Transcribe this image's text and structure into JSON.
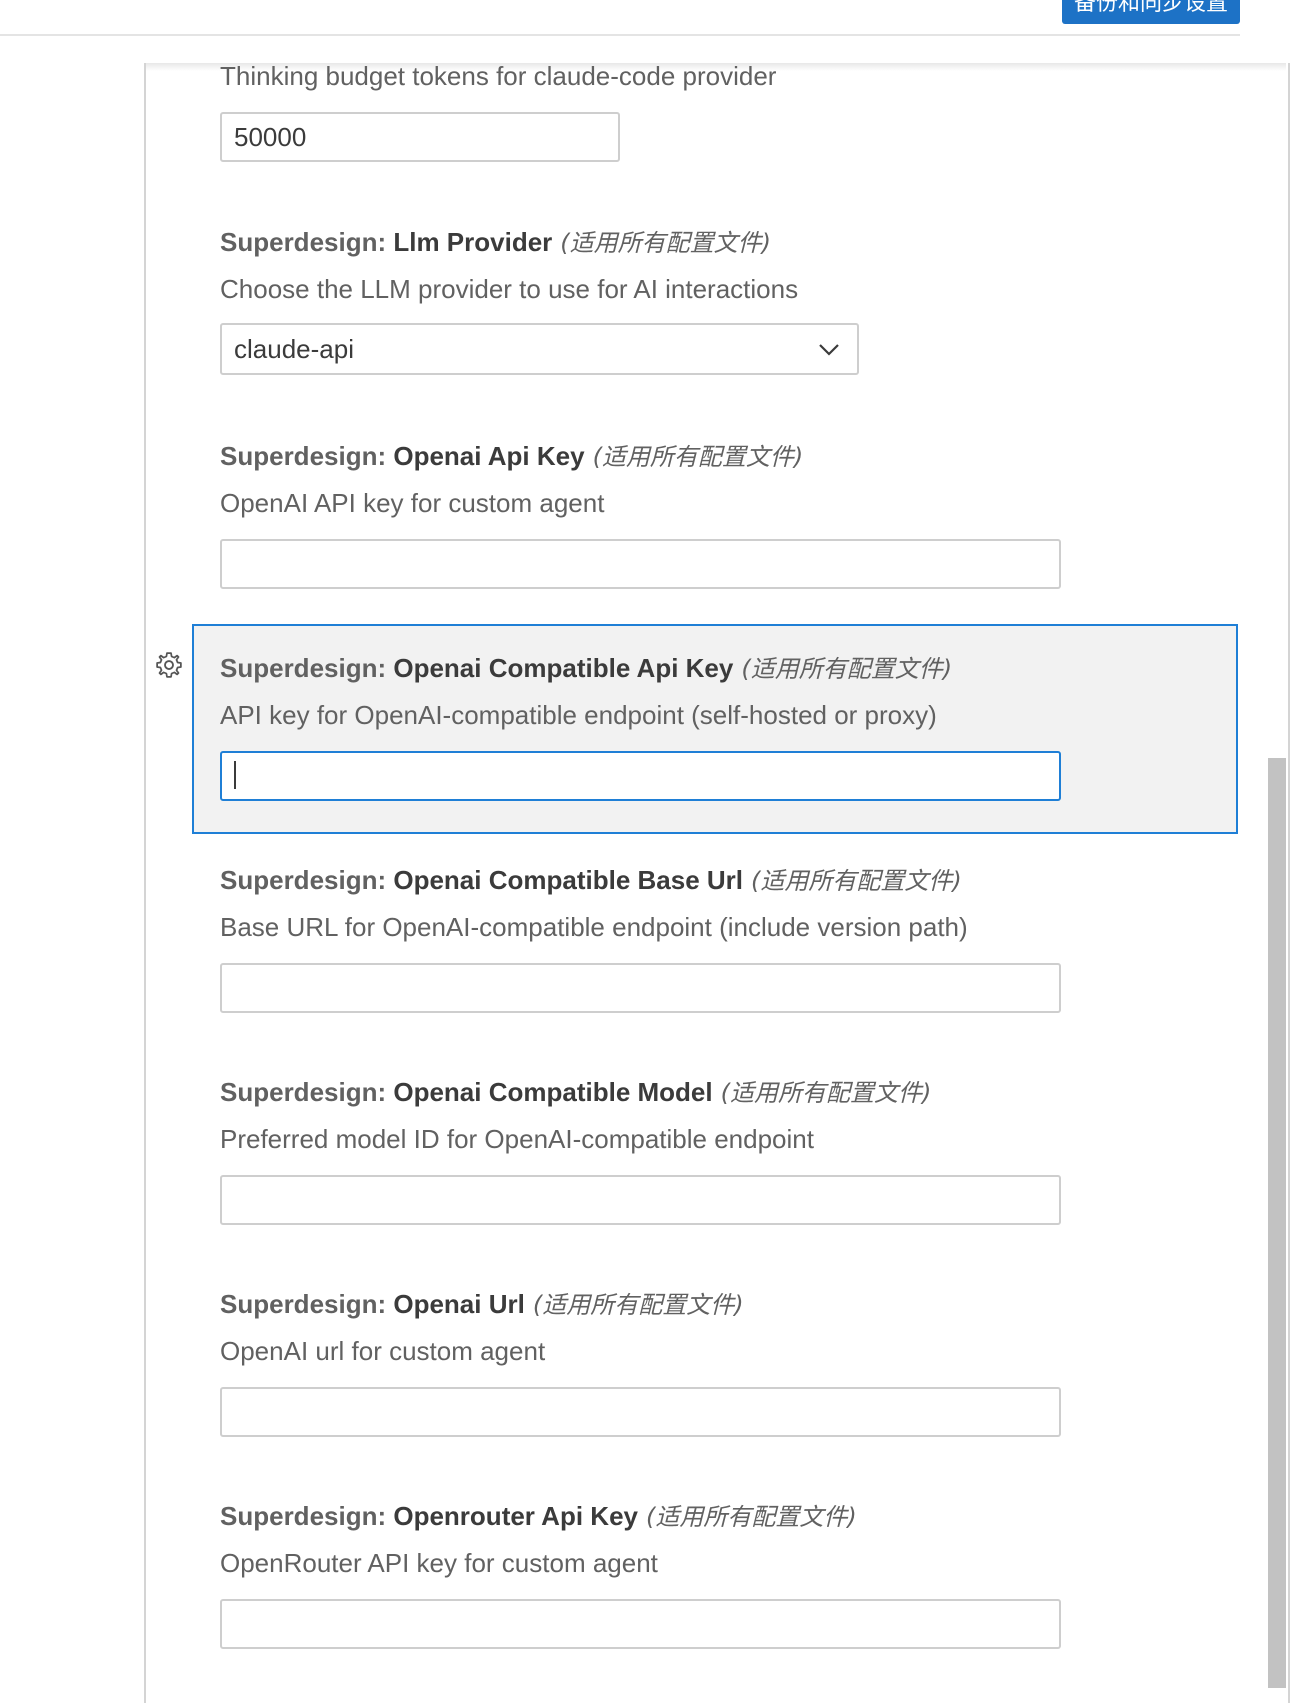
{
  "header": {
    "sync_button_label": "备份和同步设置"
  },
  "settings": {
    "thinking_budget": {
      "description": "Thinking budget tokens for claude-code provider",
      "value": "50000"
    },
    "llm_provider": {
      "prefix": "Superdesign: ",
      "name": "Llm Provider",
      "scope": "(适用所有配置文件)",
      "description": "Choose the LLM provider to use for AI interactions",
      "value": "claude-api"
    },
    "openai_api_key": {
      "prefix": "Superdesign: ",
      "name": "Openai Api Key",
      "scope": "(适用所有配置文件)",
      "description": "OpenAI API key for custom agent",
      "value": ""
    },
    "openai_compatible_api_key": {
      "prefix": "Superdesign: ",
      "name": "Openai Compatible Api Key",
      "scope": "(适用所有配置文件)",
      "description": "API key for OpenAI-compatible endpoint (self-hosted or proxy)",
      "value": ""
    },
    "openai_compatible_base_url": {
      "prefix": "Superdesign: ",
      "name": "Openai Compatible Base Url",
      "scope": "(适用所有配置文件)",
      "description": "Base URL for OpenAI-compatible endpoint (include version path)",
      "value": ""
    },
    "openai_compatible_model": {
      "prefix": "Superdesign: ",
      "name": "Openai Compatible Model",
      "scope": "(适用所有配置文件)",
      "description": "Preferred model ID for OpenAI-compatible endpoint",
      "value": ""
    },
    "openai_url": {
      "prefix": "Superdesign: ",
      "name": "Openai Url",
      "scope": "(适用所有配置文件)",
      "description": "OpenAI url for custom agent",
      "value": ""
    },
    "openrouter_api_key": {
      "prefix": "Superdesign: ",
      "name": "Openrouter Api Key",
      "scope": "(适用所有配置文件)",
      "description": "OpenRouter API key for custom agent",
      "value": ""
    }
  },
  "icons": {
    "row_gear": "gear-icon",
    "select_arrow": "chevron-down-icon"
  },
  "colors": {
    "focus_border": "#1f7fd6",
    "button_bg": "#1d72c6",
    "focused_row_bg": "#f2f2f2"
  }
}
